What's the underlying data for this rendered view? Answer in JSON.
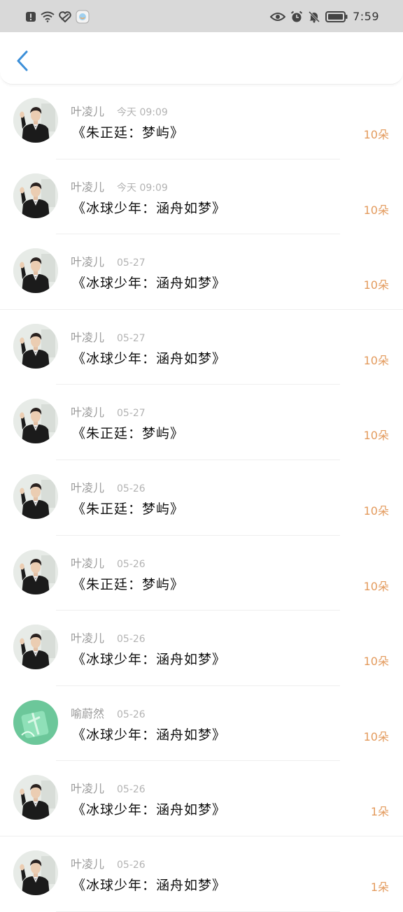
{
  "status_bar": {
    "time": "7:59",
    "left_icons": [
      "alert-icon",
      "wifi-icon",
      "heart-icon",
      "app-icon"
    ],
    "right_icons": [
      "eye-icon",
      "alarm-icon",
      "mute-icon",
      "battery-icon"
    ]
  },
  "header": {
    "back_icon": "chevron-left-icon"
  },
  "items": [
    {
      "name": "叶凌儿",
      "time": "今天 09:09",
      "title": "《朱正廷：梦屿》",
      "count": "10朵",
      "avatar": "person"
    },
    {
      "name": "叶凌儿",
      "time": "今天 09:09",
      "title": "《冰球少年：涵舟如梦》",
      "count": "10朵",
      "avatar": "person"
    },
    {
      "name": "叶凌儿",
      "time": "05-27",
      "title": "《冰球少年：涵舟如梦》",
      "count": "10朵",
      "avatar": "person"
    },
    {
      "name": "叶凌儿",
      "time": "05-27",
      "title": "《冰球少年：涵舟如梦》",
      "count": "10朵",
      "avatar": "person"
    },
    {
      "name": "叶凌儿",
      "time": "05-27",
      "title": "《朱正廷：梦屿》",
      "count": "10朵",
      "avatar": "person"
    },
    {
      "name": "叶凌儿",
      "time": "05-26",
      "title": "《朱正廷：梦屿》",
      "count": "10朵",
      "avatar": "person"
    },
    {
      "name": "叶凌儿",
      "time": "05-26",
      "title": "《朱正廷：梦屿》",
      "count": "10朵",
      "avatar": "person"
    },
    {
      "name": "叶凌儿",
      "time": "05-26",
      "title": "《冰球少年：涵舟如梦》",
      "count": "10朵",
      "avatar": "person"
    },
    {
      "name": "喻蔚然",
      "time": "05-26",
      "title": "《冰球少年：涵舟如梦》",
      "count": "10朵",
      "avatar": "green"
    },
    {
      "name": "叶凌儿",
      "time": "05-26",
      "title": "《冰球少年：涵舟如梦》",
      "count": "1朵",
      "avatar": "person"
    },
    {
      "name": "叶凌儿",
      "time": "05-26",
      "title": "《冰球少年：涵舟如梦》",
      "count": "1朵",
      "avatar": "person"
    }
  ],
  "colors": {
    "accent": "#e39a5c",
    "back": "#3c8fd8",
    "status_bar": "#d9d9d9"
  }
}
